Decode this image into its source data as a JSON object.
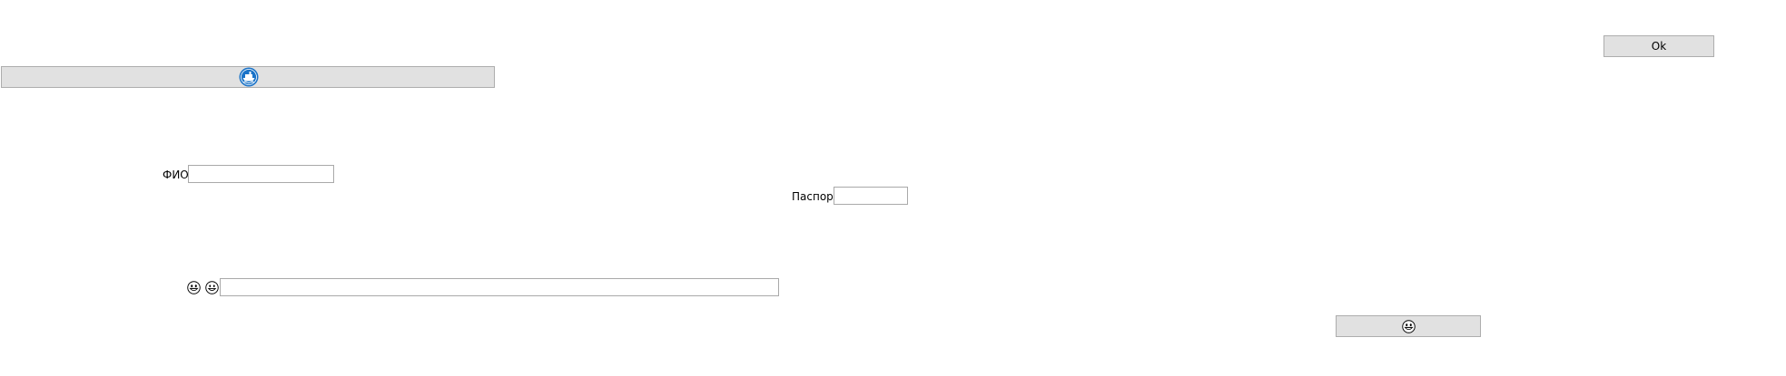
{
  "buttons": {
    "ok_label": "Ok",
    "top_bar_icon": "ship-icon",
    "bottom_icon": "grinning-face-icon"
  },
  "form": {
    "fio_label": "ФИО",
    "fio_value": "",
    "passport_label": "Паспорт",
    "passport_value": "",
    "wide_value": ""
  },
  "icons": {
    "face_1": "grinning-face-icon",
    "face_2": "grinning-face-icon"
  },
  "colors": {
    "button_bg": "#e1e1e1",
    "button_border": "#adadad",
    "input_border": "#a9a9a9",
    "ship_icon_blue": "#1a73c8"
  }
}
